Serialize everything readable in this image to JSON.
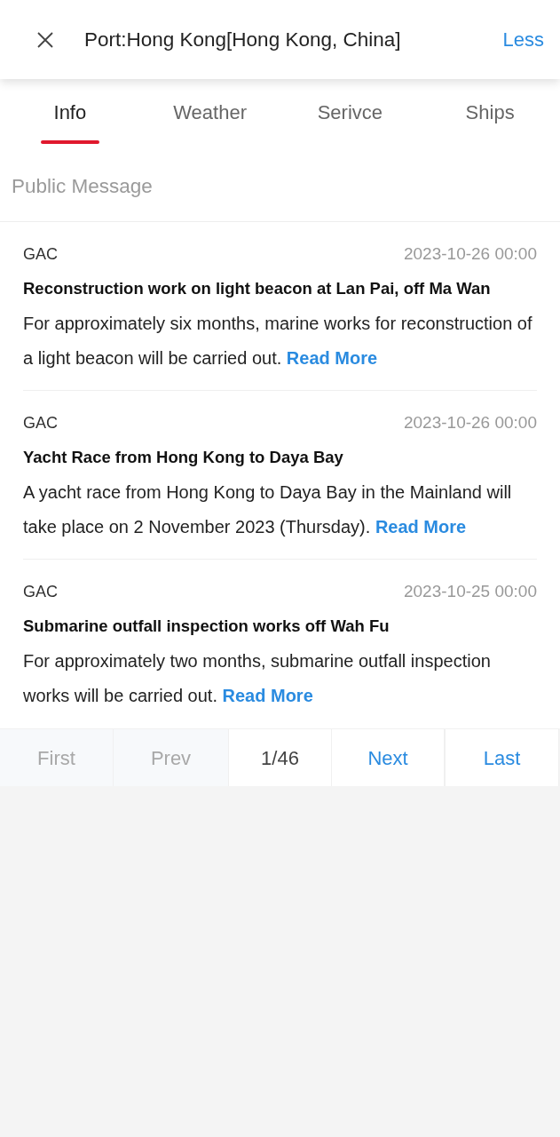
{
  "header": {
    "title": "Port:Hong Kong[Hong Kong, China]",
    "action": "Less"
  },
  "tabs": [
    {
      "label": "Info",
      "selected": true
    },
    {
      "label": "Weather",
      "selected": false
    },
    {
      "label": "Serivce",
      "selected": false
    },
    {
      "label": "Ships",
      "selected": false
    }
  ],
  "section_title": "Public Message",
  "messages": [
    {
      "source": "GAC",
      "date": "2023-10-26 00:00",
      "title": "Reconstruction work on light beacon at Lan Pai, off Ma Wan",
      "body": "For approximately six months, marine works for reconstruction of a light beacon will be carried out.",
      "link": "Read More"
    },
    {
      "source": "GAC",
      "date": "2023-10-26 00:00",
      "title": "Yacht Race from Hong Kong to Daya Bay",
      "body": "A yacht race from Hong Kong to Daya Bay in the Mainland will take place on 2 November 2023 (Thursday).",
      "link": "Read More"
    },
    {
      "source": "GAC",
      "date": "2023-10-25 00:00",
      "title": "Submarine outfall inspection works off Wah Fu",
      "body": "For approximately two months, submarine outfall inspection works will be carried out.",
      "link": "Read More"
    }
  ],
  "pagination": [
    {
      "kind": "button",
      "label": "First",
      "disabled": true
    },
    {
      "kind": "button",
      "label": "Prev",
      "disabled": true
    },
    {
      "kind": "page",
      "label": "1/46"
    },
    {
      "kind": "button",
      "label": "Next",
      "disabled": false
    },
    {
      "kind": "button",
      "label": "Last",
      "disabled": false
    }
  ]
}
